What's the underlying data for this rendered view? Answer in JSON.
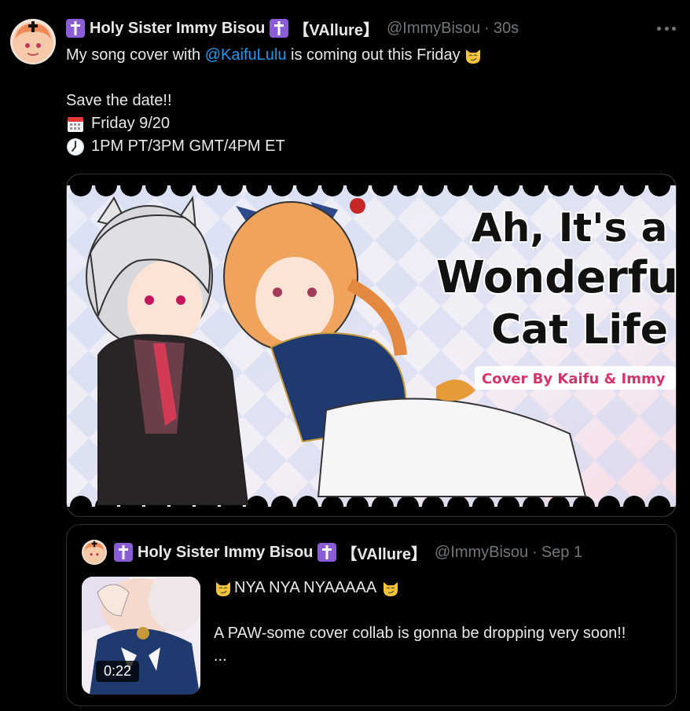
{
  "tweet": {
    "display_name": "Holy Sister Immy Bisou",
    "affiliation": "【VAllure】",
    "handle": "@ImmyBisou",
    "time": "30s",
    "text_before_mention": "My song cover with ",
    "mention": "@KaifuLulu",
    "text_after_mention": " is coming out this Friday",
    "line_save": "Save the date!!",
    "line_date": "Friday 9/20",
    "line_time": "1PM PT/3PM GMT/4PM ET"
  },
  "media": {
    "title_line1": "Ah, It's a",
    "title_line2": "Wonderful",
    "title_line3": "Cat Life",
    "subtitle": "Cover By Kaifu & Immy"
  },
  "quote": {
    "display_name": "Holy Sister Immy Bisou",
    "affiliation": "【VAllure】",
    "handle": "@ImmyBisou",
    "date": "Sep 1",
    "video_duration": "0:22",
    "line1": "NYA NYA NYAAAAA",
    "line2": "A PAW-some cover collab is gonna be dropping very soon!!",
    "line3": "..."
  },
  "colors": {
    "background": "#000000",
    "text": "#e7e9ea",
    "muted": "#71767b",
    "link": "#1d9bf0",
    "cross_badge": "#8a5cd6",
    "subtitle": "#d6336c"
  },
  "icons": [
    "latin-cross-icon",
    "smirk-cat-icon",
    "calendar-icon",
    "clock-icon",
    "more-icon"
  ]
}
